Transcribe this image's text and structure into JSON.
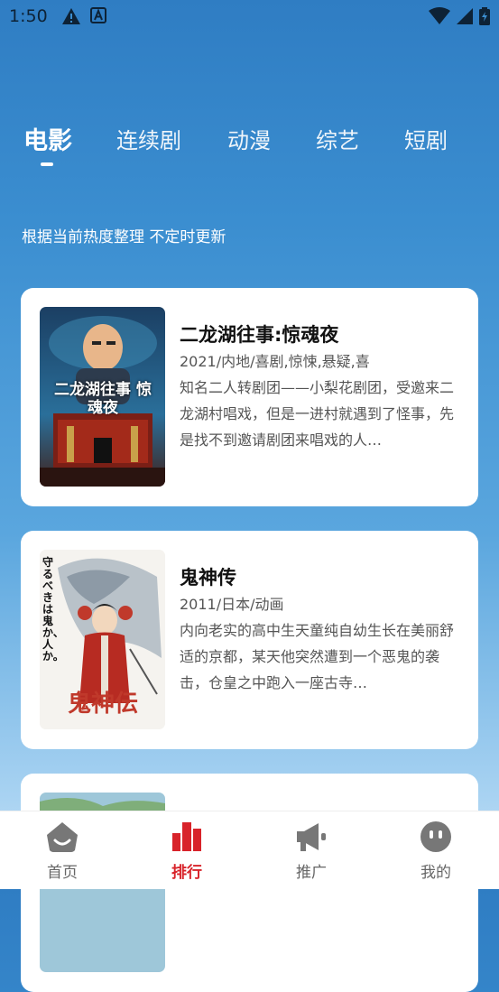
{
  "status_bar": {
    "time": "1:50",
    "icons": [
      "warning-icon",
      "notification-a-icon",
      "wifi-icon",
      "signal-icon",
      "battery-icon"
    ]
  },
  "tabs": [
    {
      "label": "电影",
      "active": true
    },
    {
      "label": "连续剧",
      "active": false
    },
    {
      "label": "动漫",
      "active": false
    },
    {
      "label": "综艺",
      "active": false
    },
    {
      "label": "短剧",
      "active": false
    }
  ],
  "subtitle": "根据当前热度整理 不定时更新",
  "items": [
    {
      "title": "二龙湖往事:惊魂夜",
      "meta": "2021/内地/喜剧,惊悚,悬疑,喜",
      "description": "知名二人转剧团——小梨花剧团，受邀来二龙湖村唱戏，但是一进村就遇到了怪事，先是找不到邀请剧团来唱戏的人…",
      "poster_text": "二龙湖往事 惊魂夜"
    },
    {
      "title": "鬼神传",
      "meta": "2011/日本/动画",
      "description": "内向老实的高中生天童纯自幼生长在美丽舒适的京都，某天他突然遭到一个恶鬼的袭击，仓皇之中跑入一座古寺…",
      "poster_text_vertical": "守るべきは鬼か、人か。",
      "poster_text_title": "鬼神伝"
    },
    {
      "title": "",
      "meta": "",
      "description": ""
    }
  ],
  "bottom_nav": [
    {
      "label": "首页",
      "icon": "home-icon",
      "active": false
    },
    {
      "label": "排行",
      "icon": "ranking-icon",
      "active": true
    },
    {
      "label": "推广",
      "icon": "megaphone-icon",
      "active": false
    },
    {
      "label": "我的",
      "icon": "profile-icon",
      "active": false
    }
  ],
  "colors": {
    "accent": "#d8232a",
    "gradient_top": "#2f7dc3",
    "gradient_bottom": "#cfe6f8",
    "nav_inactive": "#666666"
  }
}
